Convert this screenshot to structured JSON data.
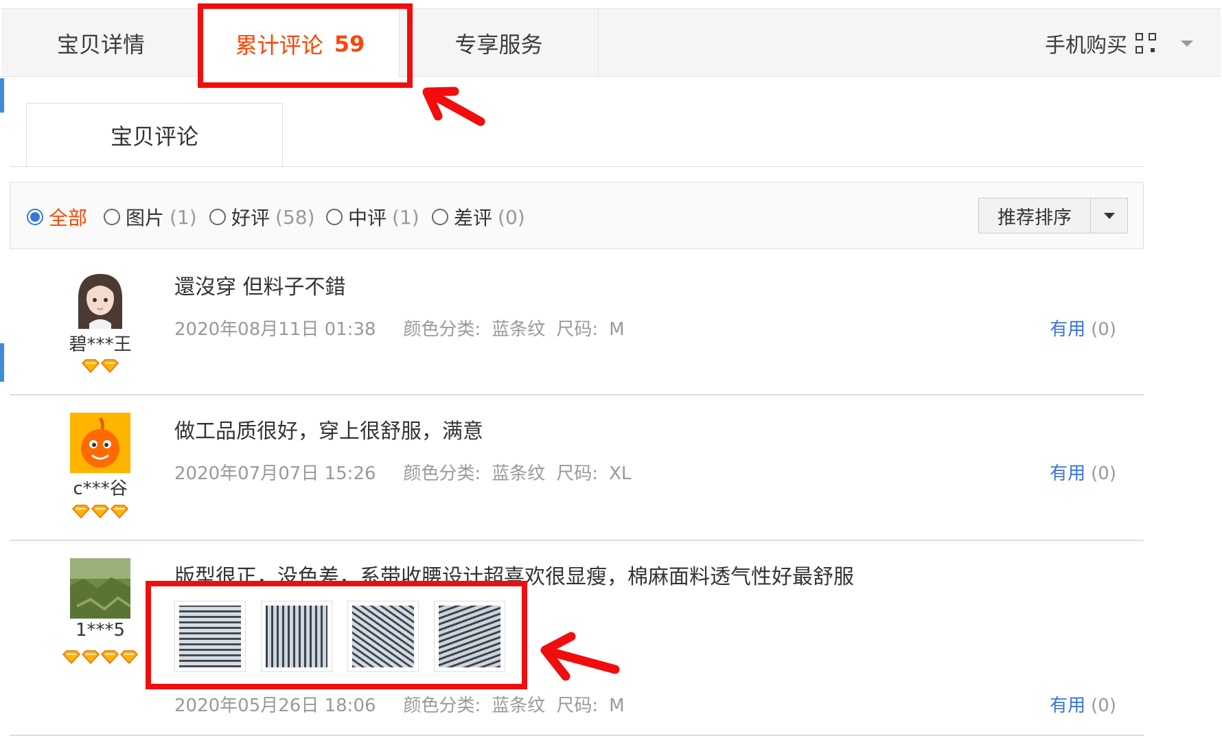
{
  "tabs": {
    "details": "宝贝详情",
    "reviews_label": "累计评论",
    "reviews_count": "59",
    "service": "专享服务",
    "mobile": "手机购买"
  },
  "subtab": "宝贝评论",
  "filters": [
    {
      "label": "全部",
      "count": ""
    },
    {
      "label": "图片",
      "count": "(1)"
    },
    {
      "label": "好评",
      "count": "(58)"
    },
    {
      "label": "中评",
      "count": "(1)"
    },
    {
      "label": "差评",
      "count": "(0)"
    }
  ],
  "sort_label": "推荐排序",
  "reviews": [
    {
      "user": "碧***王",
      "gems": 2,
      "text": "還沒穿 但料子不錯",
      "date": "2020年08月11日 01:38",
      "color_label": "颜色分类:",
      "color": "蓝条纹",
      "size_label": "尺码:",
      "size": "M",
      "useful": "有用",
      "useful_count": "(0)"
    },
    {
      "user": "c***谷",
      "gems": 3,
      "text": "做工品质很好，穿上很舒服，满意",
      "date": "2020年07月07日 15:26",
      "color_label": "颜色分类:",
      "color": "蓝条纹",
      "size_label": "尺码:",
      "size": "XL",
      "useful": "有用",
      "useful_count": "(0)"
    },
    {
      "user": "1***5",
      "gems": 4,
      "text": "版型很正，没色差，系带收腰设计超喜欢很显瘦，棉麻面料透气性好最舒服",
      "date": "2020年05月26日 18:06",
      "color_label": "颜色分类:",
      "color": "蓝条纹",
      "size_label": "尺码:",
      "size": "M",
      "useful": "有用",
      "useful_count": "(0)"
    }
  ],
  "colors": {
    "accent": "#ff4400",
    "link": "#3875d7",
    "annotation": "#f10d0d"
  }
}
